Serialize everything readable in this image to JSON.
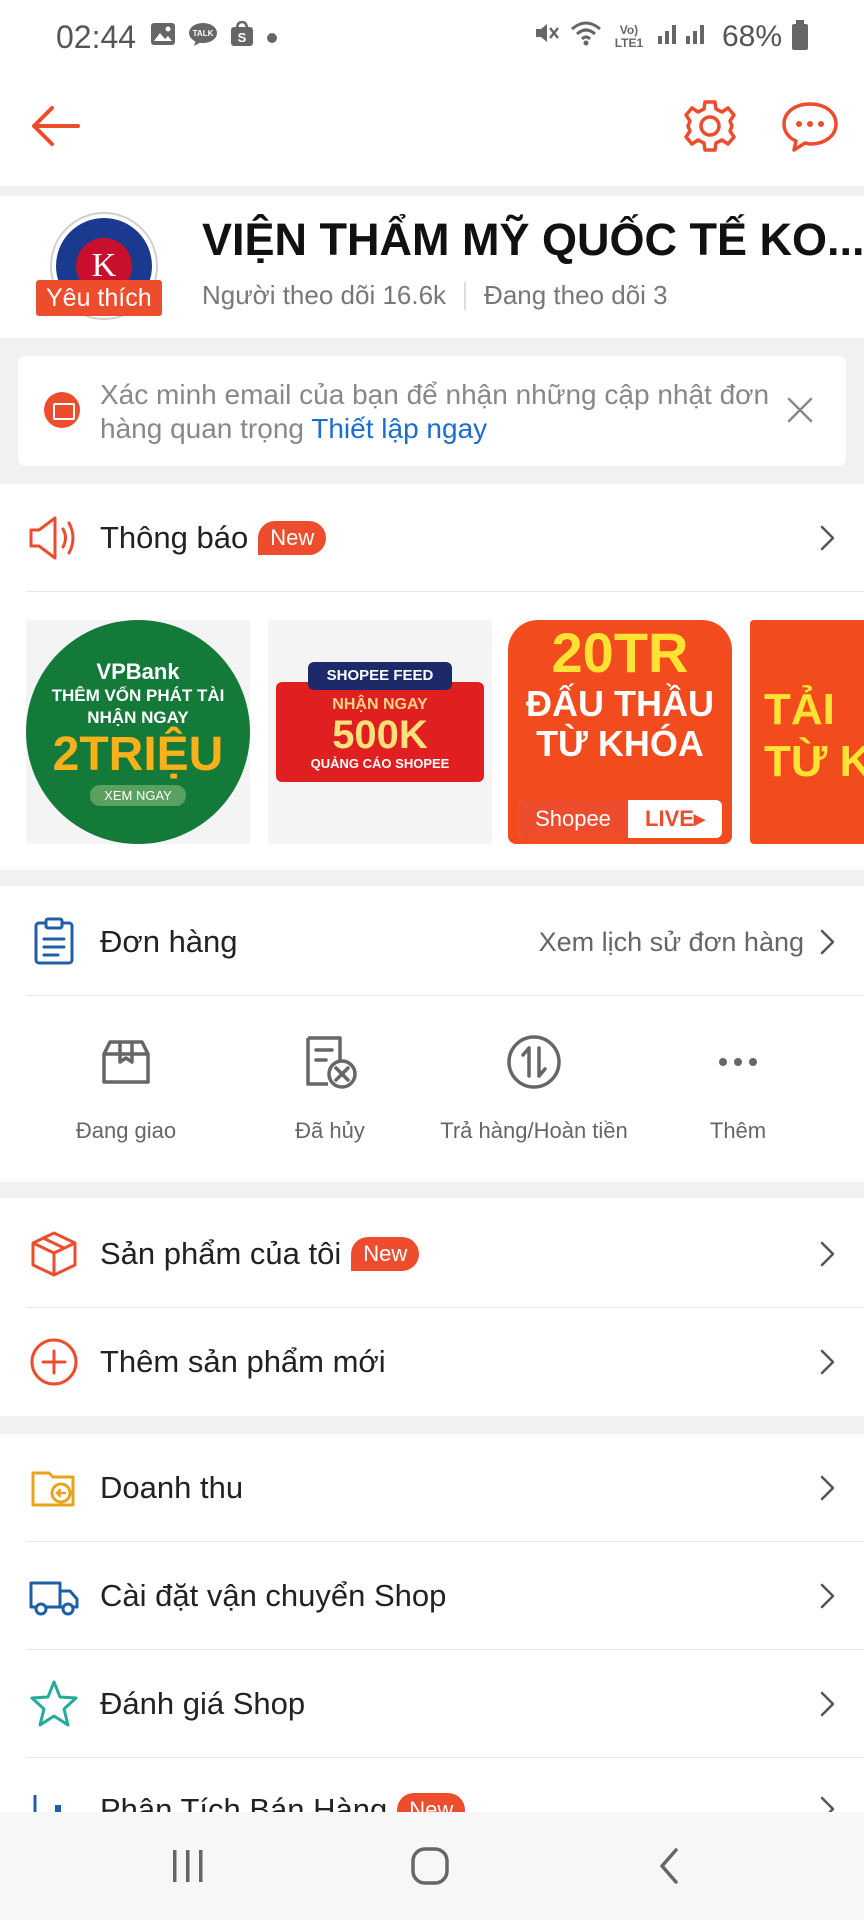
{
  "status_bar": {
    "time": "02:44",
    "notification_icons": [
      "image-icon",
      "talk-icon",
      "shop-icon",
      "dot-icon"
    ],
    "network": "Vo) LTE1",
    "battery": "68%"
  },
  "top_bar": {
    "back_icon": "arrow-left-icon",
    "settings_icon": "gear-icon",
    "chat_icon": "chat-icon",
    "accent": "#ee4d2d"
  },
  "shop": {
    "name": "VIỆN THẨM MỸ QUỐC TẾ KO...",
    "favorite_badge": "Yêu thích",
    "logo_letter": "K",
    "followers": "Người theo dõi 16.6k",
    "following": "Đang theo dõi 3"
  },
  "verify": {
    "text": "Xác minh email của bạn để nhận những cập nhật đơn hàng quan trọng",
    "link": "Thiết lập ngay"
  },
  "notifications": {
    "label": "Thông báo",
    "badge": "New"
  },
  "banners": [
    {
      "bank": "VPBank",
      "line1": "THÊM VỐN PHÁT TÀI",
      "line2": "NHẬN NGAY",
      "big": "2TRIỆU",
      "pill": "XEM NGAY"
    },
    {
      "tag": "SHOPEE FEED",
      "line1": "NHẬN NGAY",
      "big": "500K",
      "line2": "QUẢNG CÁO SHOPEE"
    },
    {
      "big": "20TR",
      "line1": "ĐẤU THẦU",
      "line2": "TỪ KHÓA",
      "shopee": "Shopee",
      "live": "LIVE▸"
    },
    {
      "line1": "TẢI",
      "line2": "TỪ K"
    }
  ],
  "orders": {
    "label": "Đơn hàng",
    "history": "Xem lịch sử đơn hàng",
    "items": [
      {
        "label": "Đang giao",
        "icon": "package-icon"
      },
      {
        "label": "Đã hủy",
        "icon": "cancelled-doc-icon"
      },
      {
        "label": "Trả hàng/Hoàn tiền",
        "icon": "return-refund-icon"
      },
      {
        "label": "Thêm",
        "icon": "more-icon"
      }
    ]
  },
  "menu": {
    "my_products": {
      "label": "Sản phẩm của tôi",
      "badge": "New"
    },
    "add_product": {
      "label": "Thêm sản phẩm mới"
    },
    "revenue": {
      "label": "Doanh thu"
    },
    "shipping": {
      "label": "Cài đặt vận chuyển Shop"
    },
    "rating": {
      "label": "Đánh giá Shop"
    },
    "analytics": {
      "label": "Phân Tích Bán Hàng",
      "badge": "New"
    }
  },
  "nav_bar": {
    "recent_icon": "recent-apps-icon",
    "home_icon": "home-icon",
    "back_icon": "back-nav-icon"
  }
}
